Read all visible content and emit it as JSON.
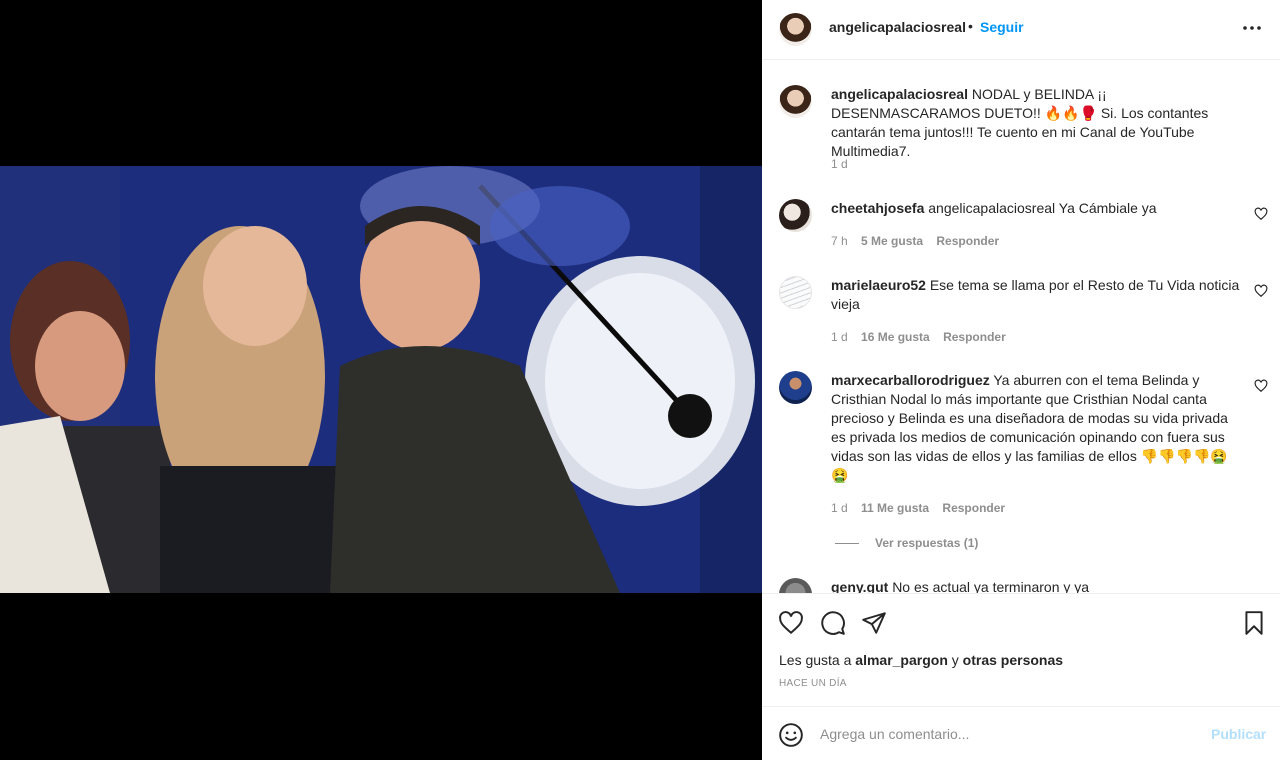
{
  "post": {
    "username": "angelicapalaciosreal",
    "separator": "•",
    "follow_label": "Seguir",
    "caption_user": "angelicapalaciosreal",
    "caption_text": "NODAL y BELINDA ¡¡ DESENMASCARAMOS DUETO!! 🔥🔥🥊 Si. Los contantes cantarán tema juntos!!! Te cuento en mi Canal de YouTube Multimedia7.",
    "caption_time": "1 d"
  },
  "comments": [
    {
      "user": "cheetahjosefa",
      "text": "angelicapalaciosreal Ya Cámbiale ya",
      "time": "7 h",
      "likes": "5 Me gusta",
      "reply": "Responder"
    },
    {
      "user": "marielaeuro52",
      "text": "Ese tema se llama por el Resto de Tu Vida noticia vieja",
      "time": "1 d",
      "likes": "16 Me gusta",
      "reply": "Responder"
    },
    {
      "user": "marxecarballorodriguez",
      "text": "Ya aburren con el tema Belinda y Cristhian Nodal lo más importante que Cristhian Nodal canta precioso y Belinda es una diseñadora de modas su vida privada es privada los medios de comunicación opinando con fuera sus vidas son las vidas de ellos y las familias de ellos 👎👎👎👎🤮🤮",
      "time": "1 d",
      "likes": "11 Me gusta",
      "reply": "Responder"
    },
    {
      "user": "geny.gut",
      "text": "No es actual ya terminaron y ya"
    }
  ],
  "view_replies": "Ver respuestas (1)",
  "likes_line": {
    "prefix": "Les gusta a",
    "user": "almar_pargon",
    "middle": "y",
    "others": "otras personas"
  },
  "timestamp": "HACE UN DÍA",
  "add_comment": {
    "placeholder": "Agrega un comentario...",
    "publish": "Publicar"
  },
  "icons": [
    "more-icon",
    "heart-icon",
    "comment-icon",
    "share-icon",
    "bookmark-icon",
    "emoji-icon"
  ],
  "colors": {
    "link_blue": "#0095f6",
    "muted": "#8e8e8e",
    "publish_disabled": "#b2dffc"
  }
}
